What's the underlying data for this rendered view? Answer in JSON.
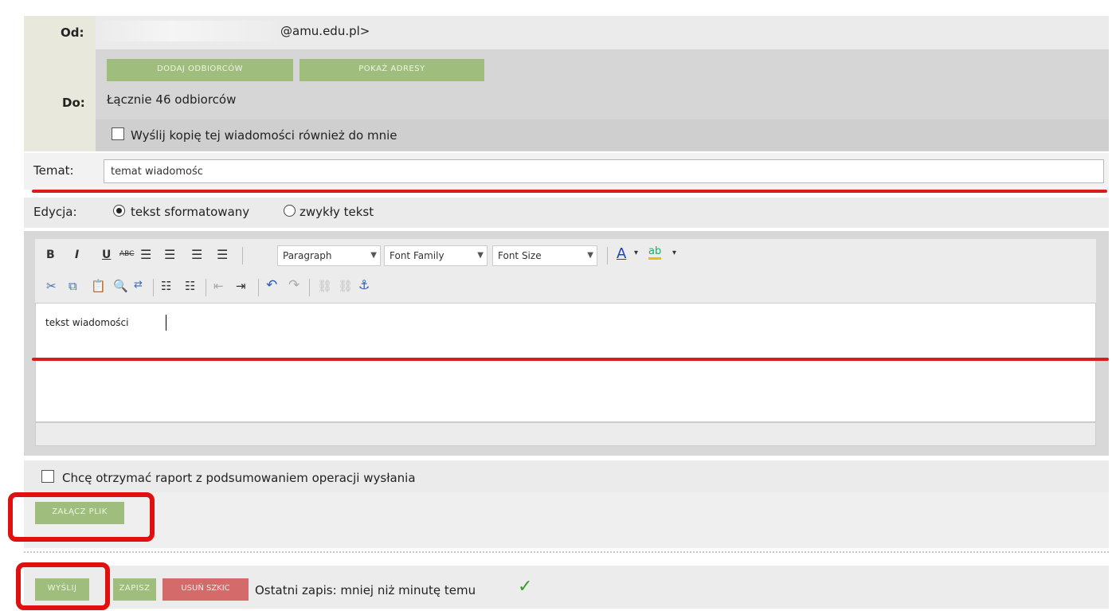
{
  "from": {
    "label": "Od:",
    "email": "@amu.edu.pl>"
  },
  "to": {
    "label": "Do:",
    "add_recipients_button": "DODAJ ODBIORCÓW",
    "show_addresses_button": "POKAŻ ADRESY",
    "total_recipients": "Łącznie 46 odbiorców",
    "copy_to_me_label": "Wyślij kopię tej wiadomości również do mnie"
  },
  "subject": {
    "label": "Temat:",
    "value": "temat wiadomośc"
  },
  "edition": {
    "label": "Edycja:",
    "option_formatted": "tekst sformatowany",
    "option_plain": "zwykły tekst",
    "selected": "tekst sformatowany"
  },
  "toolbar": {
    "bold": "B",
    "italic": "I",
    "underline": "U",
    "strikethrough": "ABC",
    "paragraph_select": "Paragraph",
    "font_family_select": "Font Family",
    "font_size_select": "Font Size",
    "font_color": "A",
    "highlight": "ab"
  },
  "editor": {
    "content": "tekst wiadomości"
  },
  "report": {
    "label": "Chcę otrzymać raport z podsumowaniem operacji wysłania"
  },
  "attach": {
    "button": "ZAŁĄCZ PLIK"
  },
  "actions": {
    "send_button": "WYŚLIJ",
    "save_button": "ZAPISZ",
    "delete_draft_button": "USUŃ SZKIC",
    "last_save_text": "Ostatni zapis: mniej niż minutę temu",
    "check_icon": "✓"
  },
  "colors": {
    "green_button": "#9fbd7d",
    "red_button": "#d46a6a",
    "highlight_red": "#e01010",
    "check_green": "#3a9a2a"
  }
}
